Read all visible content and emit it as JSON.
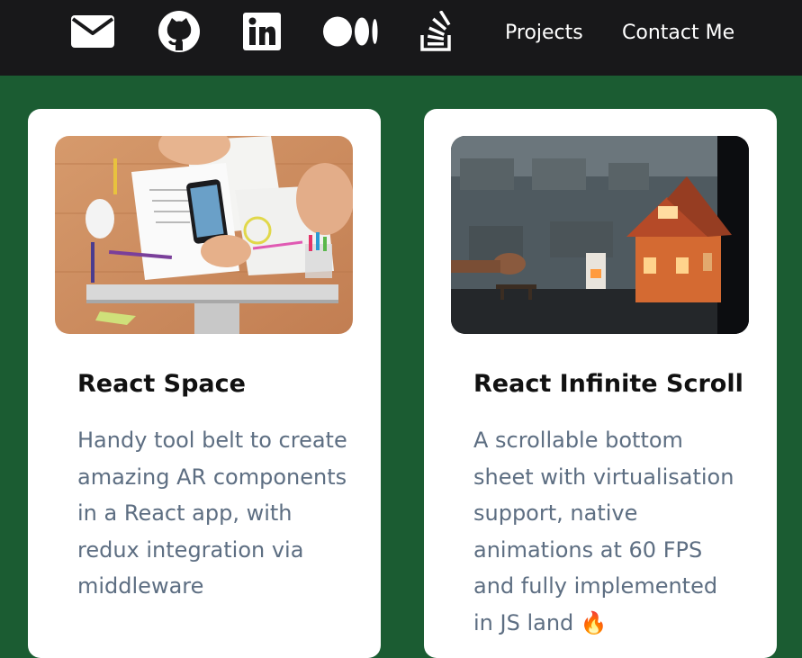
{
  "nav": {
    "icons": [
      "mail-icon",
      "github-icon",
      "linkedin-icon",
      "medium-icon",
      "stackoverflow-icon"
    ],
    "links": [
      {
        "label": "Projects"
      },
      {
        "label": "Contact Me"
      }
    ]
  },
  "cards": [
    {
      "title": "React Space",
      "description": "Handy tool belt to create amazing AR components in a React app, with redux integration via middleware",
      "image": "workspace-desk-photo"
    },
    {
      "title": "React Infinite Scroll",
      "description": "A scrollable bottom sheet with virtualisation support, native animations at 60 FPS and fully implemented in JS land",
      "trailing_emoji": "🔥",
      "image": "toy-house-photo"
    }
  ],
  "colors": {
    "background": "#1b5c32",
    "nav_background": "#18181a",
    "card_background": "#ffffff",
    "title_text": "#111111",
    "description_text": "#5d6e82"
  }
}
